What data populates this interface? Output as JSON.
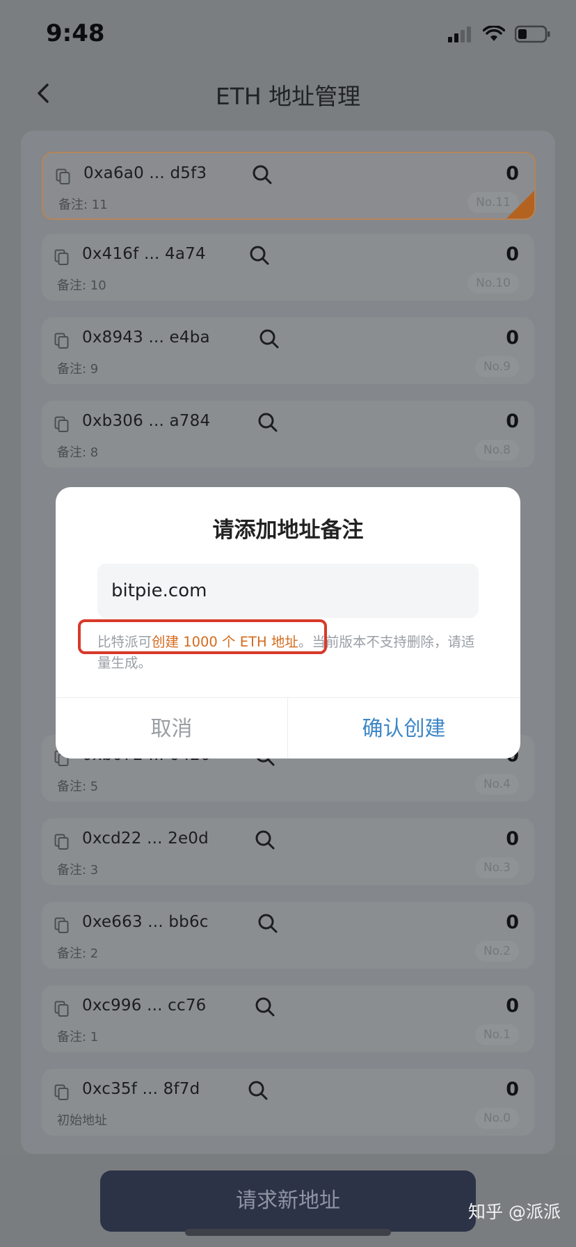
{
  "status": {
    "time": "9:48"
  },
  "nav": {
    "title": "ETH 地址管理"
  },
  "addresses": [
    {
      "addr": "0xa6a0 ... d5f3",
      "amount": "0",
      "note": "备注: 11",
      "no": "No.11",
      "active": true
    },
    {
      "addr": "0x416f ... 4a74",
      "amount": "0",
      "note": "备注: 10",
      "no": "No.10"
    },
    {
      "addr": "0x8943 ... e4ba",
      "amount": "0",
      "note": "备注: 9",
      "no": "No.9"
    },
    {
      "addr": "0xb306 ... a784",
      "amount": "0",
      "note": "备注: 8",
      "no": "No.8"
    },
    {
      "addr": "0xb072 ... 0420",
      "amount": "0",
      "note": "备注: 5",
      "no": "No.4"
    },
    {
      "addr": "0xcd22 ... 2e0d",
      "amount": "0",
      "note": "备注: 3",
      "no": "No.3"
    },
    {
      "addr": "0xe663 ... bb6c",
      "amount": "0",
      "note": "备注: 2",
      "no": "No.2"
    },
    {
      "addr": "0xc996 ... cc76",
      "amount": "0",
      "note": "备注: 1",
      "no": "No.1"
    },
    {
      "addr": "0xc35f ... 8f7d",
      "amount": "0",
      "note": "初始地址",
      "no": "No.0"
    }
  ],
  "modal": {
    "title": "请添加地址备注",
    "input_value": "bitpie.com",
    "hint_prefix": "比特派可",
    "hint_highlight": "创建 1000 个 ETH 地址",
    "hint_suffix": "。当前版本不支持删除，请适量生成。",
    "cancel_label": "取消",
    "confirm_label": "确认创建"
  },
  "footer": {
    "request_label": "请求新地址",
    "watermark": "知乎 @派派"
  },
  "colors": {
    "accent": "#d46a1c",
    "confirm": "#3d86c6",
    "highlight_box": "#d8382a"
  }
}
